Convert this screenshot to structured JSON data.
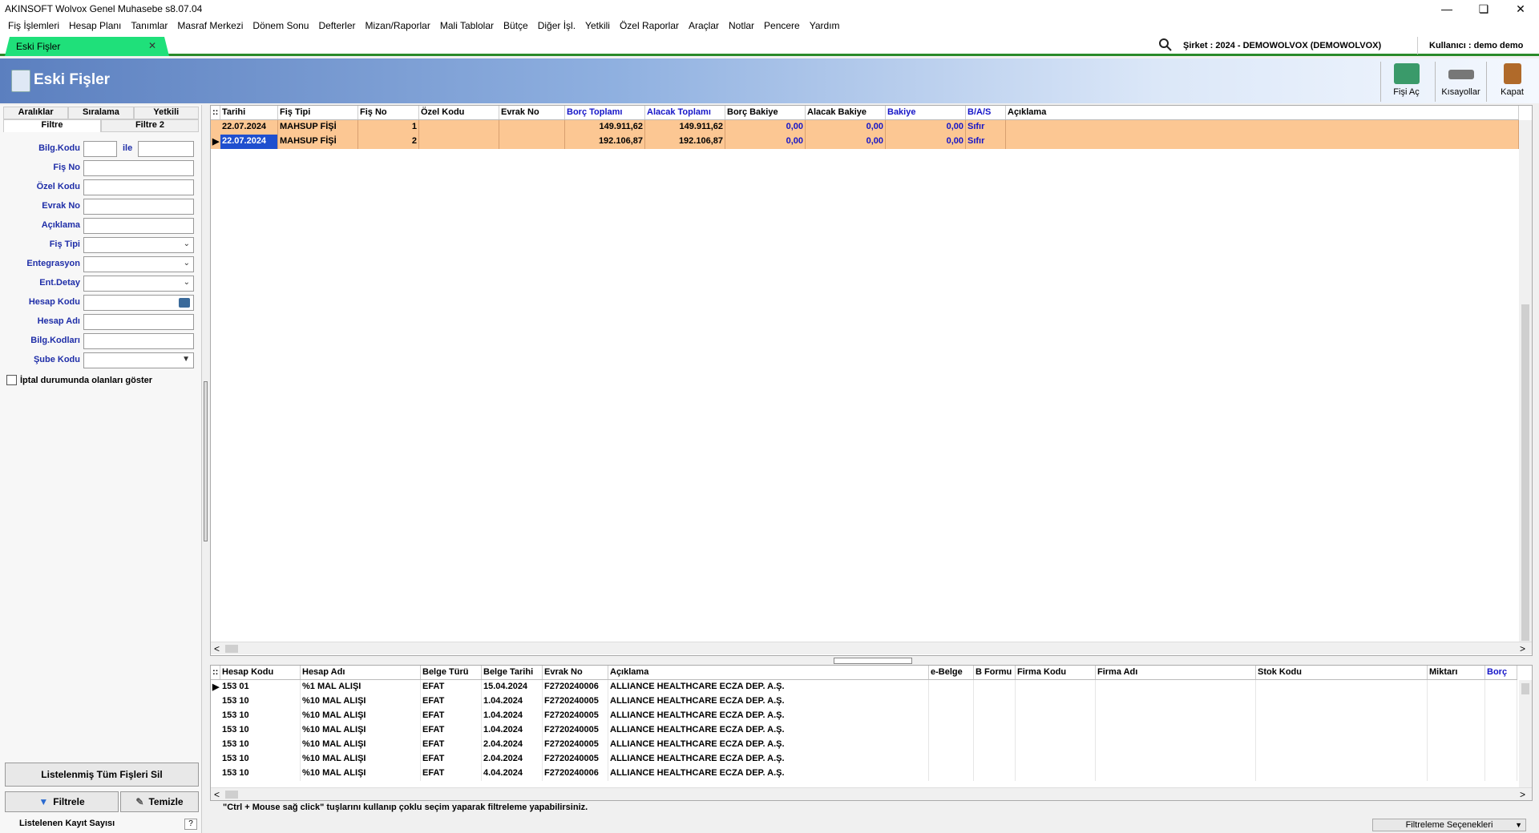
{
  "window": {
    "title": "AKINSOFT Wolvox Genel Muhasebe s8.07.04"
  },
  "menu": [
    "Fiş İşlemleri",
    "Hesap Planı",
    "Tanımlar",
    "Masraf Merkezi",
    "Dönem Sonu",
    "Defterler",
    "Mizan/Raporlar",
    "Mali Tablolar",
    "Bütçe",
    "Diğer İşl.",
    "Yetkili",
    "Özel Raporlar",
    "Araçlar",
    "Notlar",
    "Pencere",
    "Yardım"
  ],
  "tab": {
    "label": "Eski Fişler"
  },
  "header": {
    "company": "Şirket : 2024 - DEMOWOLVOX (DEMOWOLVOX)",
    "user": "Kullanıcı : demo demo"
  },
  "banner": {
    "title": "Eski Fişler"
  },
  "toolbar": {
    "open_label": "Fişi Aç",
    "shortcuts_label": "Kısayollar",
    "close_label": "Kapat"
  },
  "left_panel": {
    "tabs_top": [
      "Aralıklar",
      "Sıralama",
      "Yetkili"
    ],
    "tabs_bottom": [
      "Filtre",
      "Filtre 2"
    ],
    "fields": {
      "bilg_kodu": "Bilg.Kodu",
      "ile": "ile",
      "fis_no": "Fiş No",
      "ozel_kodu": "Özel Kodu",
      "evrak_no": "Evrak No",
      "aciklama": "Açıklama",
      "fis_tipi": "Fiş Tipi",
      "entegrasyon": "Entegrasyon",
      "ent_detay": "Ent.Detay",
      "hesap_kodu": "Hesap Kodu",
      "hesap_adi": "Hesap Adı",
      "bilg_kodlari": "Bilg.Kodları",
      "sube_kodu": "Şube Kodu"
    },
    "checkbox_label": "İptal durumunda olanları göster",
    "delete_all_label": "Listelenmiş Tüm Fişleri Sil",
    "filter_label": "Filtrele",
    "clear_label": "Temizle",
    "count_label": "Listelenen Kayıt Sayısı"
  },
  "main_grid": {
    "columns": [
      "Tarihi",
      "Fiş Tipi",
      "Fiş No",
      "Özel Kodu",
      "Evrak No",
      "Borç Toplamı",
      "Alacak Toplamı",
      "Borç Bakiye",
      "Alacak Bakiye",
      "Bakiye",
      "B/A/S",
      "Açıklama"
    ],
    "rows": [
      [
        "22.07.2024",
        "MAHSUP FİŞİ",
        "1",
        "",
        "",
        "149.911,62",
        "149.911,62",
        "0,00",
        "0,00",
        "0,00",
        "Sıfır",
        ""
      ],
      [
        "22.07.2024",
        "MAHSUP FİŞİ",
        "2",
        "",
        "",
        "192.106,87",
        "192.106,87",
        "0,00",
        "0,00",
        "0,00",
        "Sıfır",
        ""
      ]
    ]
  },
  "detail_grid": {
    "columns": [
      "Hesap Kodu",
      "Hesap Adı",
      "Belge Türü",
      "Belge Tarihi",
      "Evrak No",
      "Açıklama",
      "e-Belge",
      "B Formu",
      "Firma Kodu",
      "Firma Adı",
      "Stok Kodu",
      "Miktarı",
      "Borç"
    ],
    "rows": [
      [
        "153 01",
        "%1 MAL ALIŞI",
        "EFAT",
        "15.04.2024",
        "F2720240006",
        "ALLIANCE HEALTHCARE ECZA DEP. A.Ş.",
        "",
        "",
        "",
        "",
        "",
        "",
        ""
      ],
      [
        "153 10",
        "%10 MAL ALIŞI",
        "EFAT",
        "1.04.2024",
        "F2720240005",
        "ALLIANCE HEALTHCARE ECZA DEP. A.Ş.",
        "",
        "",
        "",
        "",
        "",
        "",
        ""
      ],
      [
        "153 10",
        "%10 MAL ALIŞI",
        "EFAT",
        "1.04.2024",
        "F2720240005",
        "ALLIANCE HEALTHCARE ECZA DEP. A.Ş.",
        "",
        "",
        "",
        "",
        "",
        "",
        ""
      ],
      [
        "153 10",
        "%10 MAL ALIŞI",
        "EFAT",
        "1.04.2024",
        "F2720240005",
        "ALLIANCE HEALTHCARE ECZA DEP. A.Ş.",
        "",
        "",
        "",
        "",
        "",
        "",
        ""
      ],
      [
        "153 10",
        "%10 MAL ALIŞI",
        "EFAT",
        "2.04.2024",
        "F2720240005",
        "ALLIANCE HEALTHCARE ECZA DEP. A.Ş.",
        "",
        "",
        "",
        "",
        "",
        "",
        ""
      ],
      [
        "153 10",
        "%10 MAL ALIŞI",
        "EFAT",
        "2.04.2024",
        "F2720240005",
        "ALLIANCE HEALTHCARE ECZA DEP. A.Ş.",
        "",
        "",
        "",
        "",
        "",
        "",
        ""
      ],
      [
        "153 10",
        "%10 MAL ALIŞI",
        "EFAT",
        "4.04.2024",
        "F2720240006",
        "ALLIANCE HEALTHCARE ECZA DEP. A.Ş.",
        "",
        "",
        "",
        "",
        "",
        "",
        ""
      ]
    ]
  },
  "status": {
    "hint": "\"Ctrl + Mouse sağ click\" tuşlarını kullanıp çoklu seçim yaparak filtreleme yapabilirsiniz.",
    "filter_options": "Filtreleme Seçenekleri"
  }
}
